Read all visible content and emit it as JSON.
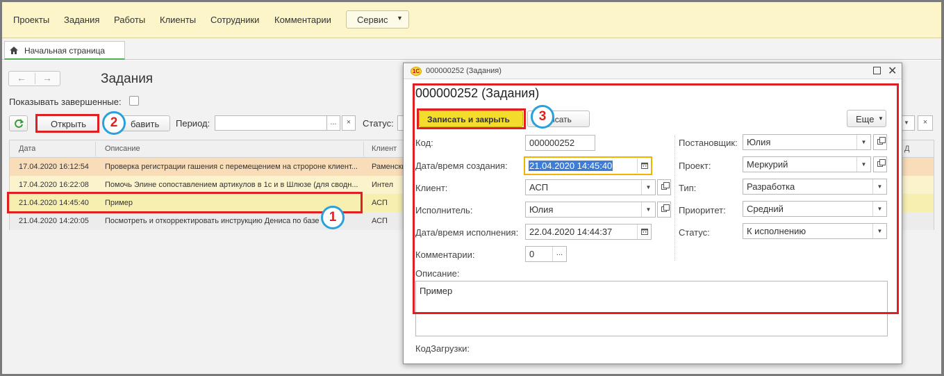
{
  "menu": {
    "items": [
      "Проекты",
      "Задания",
      "Работы",
      "Клиенты",
      "Сотрудники",
      "Комментарии"
    ],
    "service_label": "Сервис"
  },
  "tabs": {
    "home_label": "Начальная страница"
  },
  "list": {
    "title": "Задания",
    "show_done_label": "Показывать завершенные:",
    "open_label": "Открыть",
    "add_label": "бавить",
    "period_label": "Период:",
    "status_label": "Статус:",
    "dots": "...",
    "clear": "×",
    "columns": [
      "Дата",
      "Описание",
      "Клиент"
    ],
    "right_col_fragment": "Д",
    "rows": [
      {
        "date": "17.04.2020 16:12:54",
        "desc": "Проверка регистрации гашения с перемещением на стророне клиент...",
        "client": "Раменски"
      },
      {
        "date": "17.04.2020 16:22:08",
        "desc": "Помочь Элине сопоставлением артикулов в 1с и в Шлюзе (для сводн...",
        "client": "Интел"
      },
      {
        "date": "21.04.2020 14:45:40",
        "desc": "Пример",
        "client": "АСП"
      },
      {
        "date": "21.04.2020 14:20:05",
        "desc": "Посмотреть и откорректировать инструкцию Дениса по базе з",
        "client": "АСП"
      }
    ]
  },
  "badges": {
    "one": "1",
    "two": "2",
    "three": "3"
  },
  "modal": {
    "window_title": "000000252 (Задания)",
    "logo": "1С",
    "heading": "000000252 (Задания)",
    "save_close_label": "Записать и закрыть",
    "save_label": "исать",
    "more_label": "Еще",
    "fields": {
      "code_label": "Код:",
      "code_value": "000000252",
      "created_label": "Дата/время создания:",
      "created_value": "21.04.2020 14:45:40",
      "client_label": "Клиент:",
      "client_value": "АСП",
      "executor_label": "Исполнитель:",
      "executor_value": "Юлия",
      "done_label": "Дата/время исполнения:",
      "done_value": "22.04.2020 14:44:37",
      "comments_label": "Комментарии:",
      "comments_value": "0",
      "author_label": "Постановщик:",
      "author_value": "Юлия",
      "project_label": "Проект:",
      "project_value": "Меркурий",
      "type_label": "Тип:",
      "type_value": "Разработка",
      "priority_label": "Приоритет:",
      "priority_value": "Средний",
      "status_label": "Статус:",
      "status_value": "К исполнению",
      "desc_label": "Описание:",
      "desc_value": "Пример",
      "load_code_label": "КодЗагрузки:"
    }
  },
  "colors": {
    "menu_bg": "#fbf5c9",
    "accent_yellow": "#f3dc2b",
    "highlight_red": "#e02020",
    "badge_blue": "#2aa0dc",
    "row_orange": "#f9dcb8",
    "row_yellow": "#fbf3cc",
    "row_selected": "#f7efb0",
    "row_grey": "#ececec"
  }
}
